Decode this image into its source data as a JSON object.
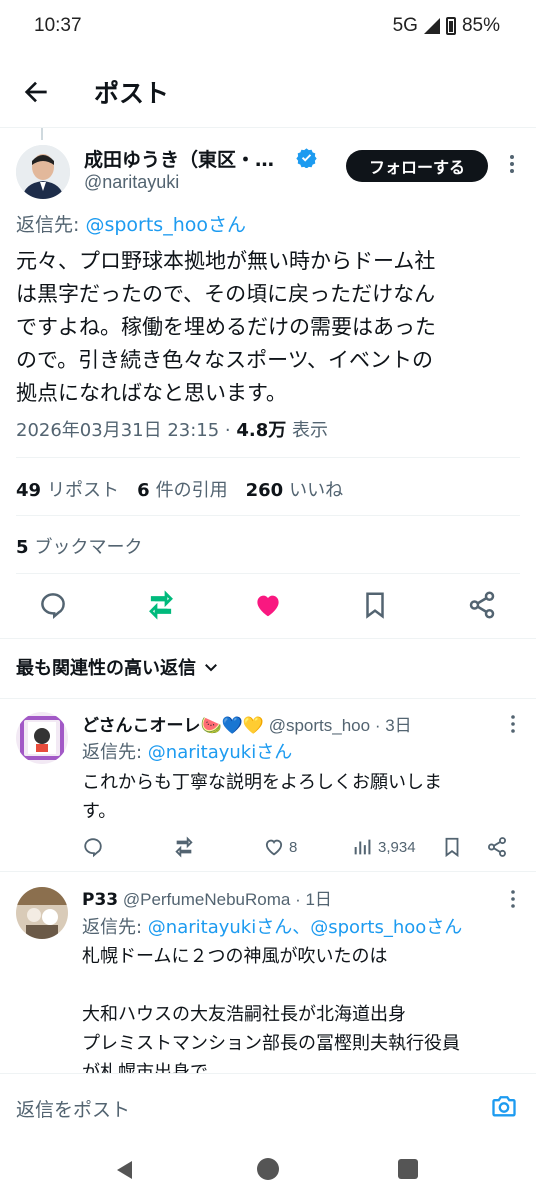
{
  "status_bar": {
    "time": "10:37",
    "network": "5G",
    "battery": "85%"
  },
  "header": {
    "title": "ポスト"
  },
  "post": {
    "author_name": "成田ゆうき（東区・…",
    "author_handle": "@naritayuki",
    "follow_label": "フォローする",
    "reply_to_prefix": "返信先: ",
    "reply_to_mention": "@sports_hooさん",
    "text": "元々、プロ野球本拠地が無い時からドーム社\nは黒字だったので、その頃に戻っただけなん\nですよね。稼働を埋めるだけの需要はあった\nので。引き続き色々なスポーツ、イベントの\n拠点になればなと思います。",
    "timestamp": "2026年03月31日 23:15 · ",
    "views_count": "4.8万",
    "views_label": " 表示",
    "reposts_count": "49",
    "reposts_label": "リポスト",
    "quotes_count": "6",
    "quotes_label": "件の引用",
    "likes_count": "260",
    "likes_label": "いいね",
    "bookmarks_count": "5",
    "bookmarks_label": "ブックマーク",
    "liked": true,
    "reposted": true
  },
  "sort": {
    "label": "最も関連性の高い返信"
  },
  "replies": [
    {
      "name": "どさんこオーレ🍉💙💛",
      "handle": " @sports_hoo · 3日",
      "reply_to_prefix": "返信先: ",
      "reply_to_mention": "@naritayukiさん",
      "text": "これからも丁寧な説明をよろしくお願いしま\nす。",
      "likes": "8",
      "views": "3,934"
    },
    {
      "name": "P33",
      "handle": " @PerfumeNebuRoma · 1日",
      "reply_to_prefix": "返信先: ",
      "reply_to_mention": "@naritayukiさん、@sports_hooさん",
      "text": "札幌ドームに２つの神風が吹いたのは\n\n大和ハウスの大友浩嗣社長が北海道出身\nプレミストマンション部長の冨樫則夫執行役員\nが札幌市出身で"
    }
  ],
  "composer": {
    "placeholder": "返信をポスト"
  },
  "colors": {
    "accent": "#1d9bf0",
    "like": "#f91880",
    "repost": "#00ba7c"
  }
}
